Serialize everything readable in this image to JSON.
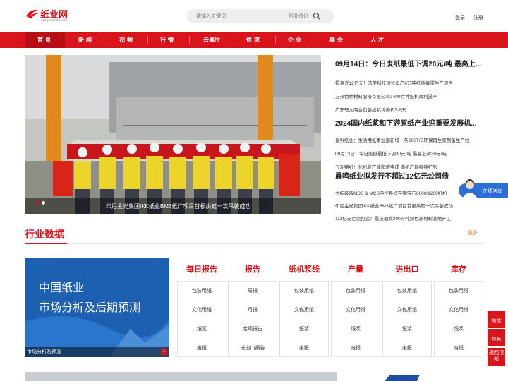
{
  "header": {
    "logo_text": "纸业网",
    "logo_sub": "CHINAPAPER.NET",
    "search_placeholder": "请输入关键词",
    "search_category": "纸业资讯",
    "login": "登录",
    "register": "注册"
  },
  "nav": [
    "首页",
    "新闻",
    "视频",
    "行情",
    "云展厅",
    "供求",
    "企业",
    "展会",
    "人才"
  ],
  "slider": {
    "caption": "印尼金光集团IKK纸业BM3纸厂项目首根烘缸一次吊装成功"
  },
  "news": [
    {
      "title": "09月14日：今日废纸最低下调20元/吨 最高上...",
      "items": [
        "投资近12亿元！洁美科技建设年产6万吨纸质载带生产项目",
        "万邦特种材料股份有限公司3400特种纸机顺利投产",
        "广东理文两台包装纸机将停机5-8天"
      ]
    },
    {
      "title": "2024国内纸浆和下游原纸产业迎重要发展机...",
      "items": [
        "景兴纸业：生活用纸事业部新增一条200T/D环保再生浆制备生产线",
        "09月13日：今日废纸最低下调30元/吨 最高上调30元/吨",
        "五洲特纸：化机浆产能爬坡完成 造纸产能持续扩张"
      ]
    },
    {
      "title": "晨鸣纸业拟发行不超过12亿元公司债",
      "items": [
        "大指装备MDS & MCS电控系统在锦宝石6600/1200纸机",
        "印尼金光集团IKK纸业BM3纸厂项目首根烘缸一次吊装成功",
        "112亿元巨资打造！重庆理文200万吨绿色新材料基地开工"
      ]
    }
  ],
  "section": {
    "title": "行业数据",
    "more": "更多"
  },
  "banner": {
    "line1": "中国纸业",
    "line2": "市场分析及后期预测",
    "caption": "市场分析及预测",
    "page": "1"
  },
  "data_columns": [
    {
      "title": "每日报告",
      "items": [
        "包装用纸",
        "文化用纸",
        "纸浆",
        "废纸"
      ]
    },
    {
      "title": "报告",
      "items": [
        "周报",
        "月报",
        "宏观报告",
        "进出口报告"
      ]
    },
    {
      "title": "纸机浆线",
      "items": [
        "包装用纸",
        "文化用纸",
        "纸浆",
        "废纸"
      ]
    },
    {
      "title": "产量",
      "items": [
        "包装用纸",
        "文化用纸",
        "纸浆",
        "废纸"
      ]
    },
    {
      "title": "进出口",
      "items": [
        "包装用纸",
        "文化用纸",
        "纸浆",
        "废纸"
      ]
    },
    {
      "title": "库存",
      "items": [
        "包装用纸",
        "文化用纸",
        "纸浆",
        "废纸"
      ]
    }
  ],
  "chat": {
    "label": "在线咨询"
  },
  "side_buttons": [
    "微信",
    "视频",
    "返回顶部"
  ],
  "colors": {
    "brand_red": "#d9141b",
    "chat_blue": "#2b6fd6"
  }
}
